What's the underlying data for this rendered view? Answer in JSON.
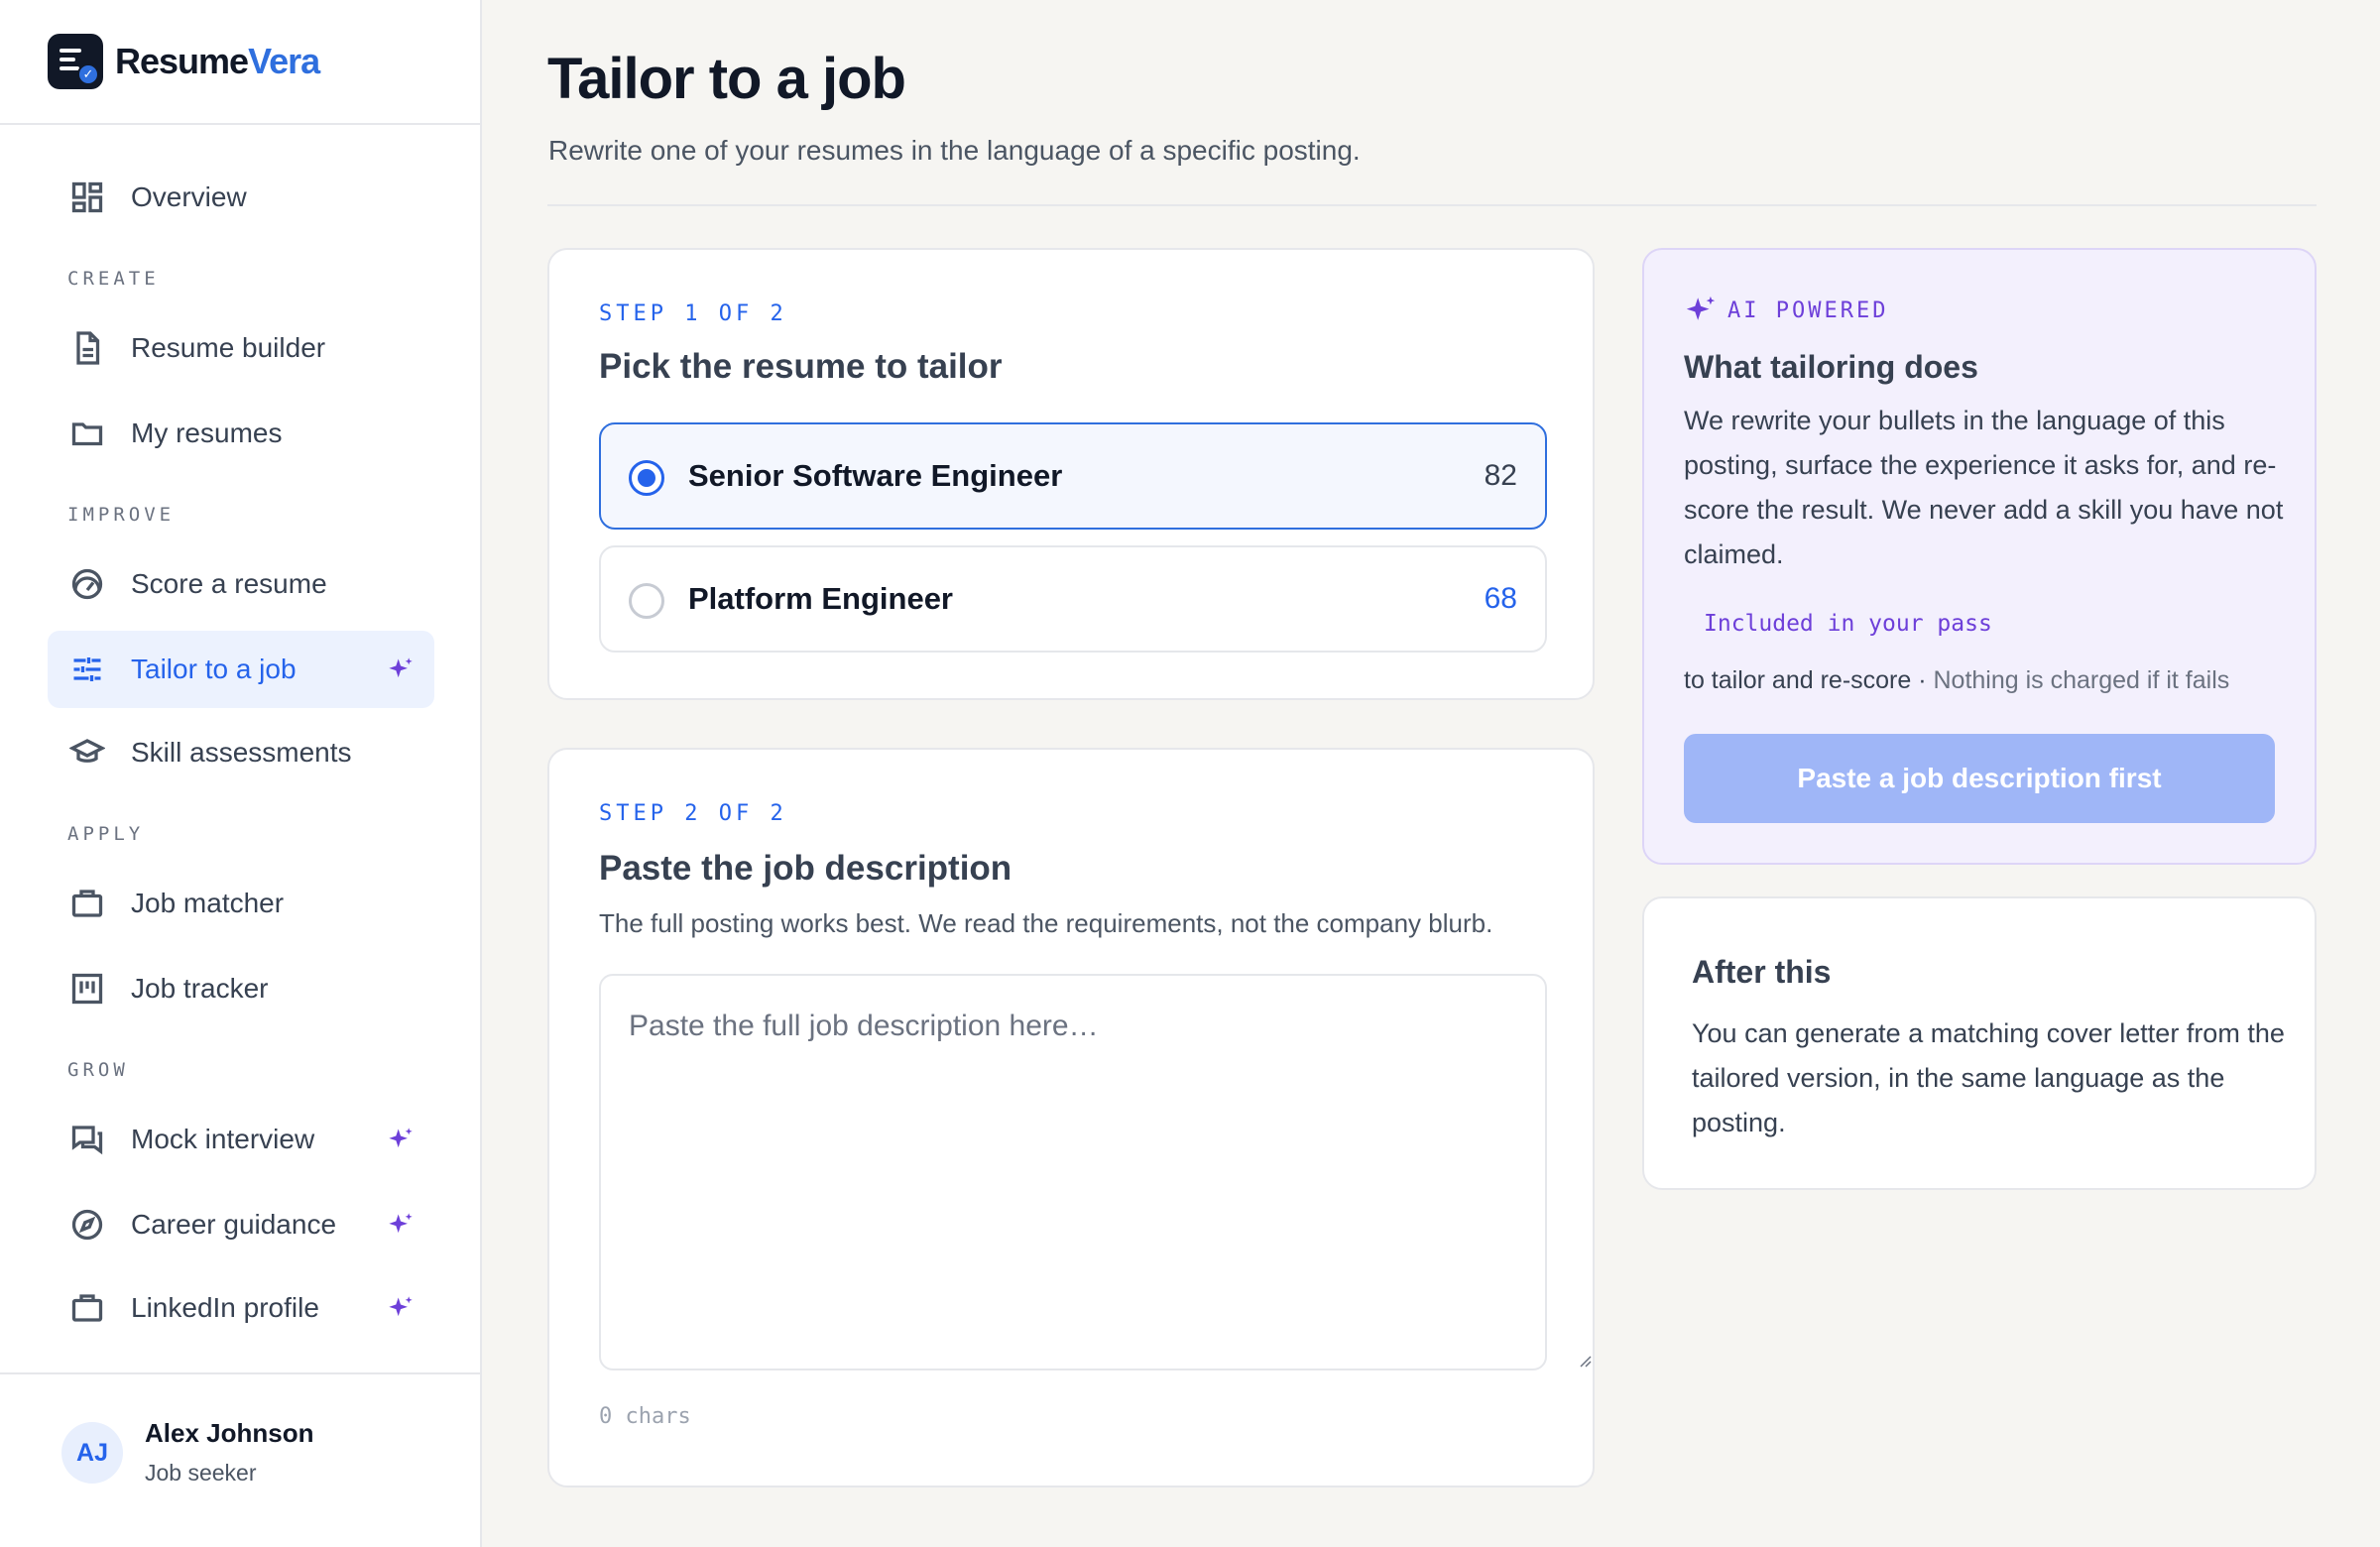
{
  "brand": {
    "name_main": "Resume",
    "name_accent": "Vera"
  },
  "sidebar": {
    "overview": "Overview",
    "sections": {
      "create": "CREATE",
      "improve": "IMPROVE",
      "apply": "APPLY",
      "grow": "GROW"
    },
    "items": {
      "resume_builder": "Resume builder",
      "my_resumes": "My resumes",
      "score_resume": "Score a resume",
      "tailor_job": "Tailor to a job",
      "skill_assessments": "Skill assessments",
      "job_matcher": "Job matcher",
      "job_tracker": "Job tracker",
      "mock_interview": "Mock interview",
      "career_guidance": "Career guidance",
      "linkedin_profile": "LinkedIn profile"
    },
    "active_item": "tailor_job"
  },
  "user": {
    "initials": "AJ",
    "name": "Alex Johnson",
    "role": "Job seeker"
  },
  "page": {
    "title": "Tailor to a job",
    "subtitle": "Rewrite one of your resumes in the language of a specific posting."
  },
  "step1": {
    "label": "STEP 1 OF 2",
    "title": "Pick the resume to tailor",
    "resumes": [
      {
        "name": "Senior Software Engineer",
        "score": "82",
        "selected": true
      },
      {
        "name": "Platform Engineer",
        "score": "68",
        "selected": false
      }
    ]
  },
  "step2": {
    "label": "STEP 2 OF 2",
    "title": "Paste the job description",
    "help": "The full posting works best. We read the requirements, not the company blurb.",
    "placeholder": "Paste the full job description here…",
    "value": "",
    "chars": "0 chars"
  },
  "ai_panel": {
    "badge": "AI POWERED",
    "title": "What tailoring does",
    "body": "We rewrite your bullets in the language of this posting, surface the experience it asks for, and re-score the result. We never add a skill you have not claimed.",
    "included": "Included in your pass",
    "note_main": "to tailor and re-score · ",
    "note_muted": "Nothing is charged if it fails",
    "button": "Paste a job description first"
  },
  "after": {
    "title": "After this",
    "body": "You can generate a matching cover letter from the tailored version, in the same language as the posting."
  },
  "colors": {
    "accent": "#2563eb",
    "ai": "#6d3fd9",
    "score_low": "#2563eb",
    "score_high": "#374151"
  },
  "icons": {
    "overview": "grid-icon",
    "resume_builder": "document-icon",
    "my_resumes": "folder-icon",
    "score_resume": "gauge-icon",
    "tailor_job": "sliders-icon",
    "skill_assessments": "graduation-cap-icon",
    "job_matcher": "briefcase-icon",
    "job_tracker": "kanban-icon",
    "mock_interview": "chat-icon",
    "career_guidance": "compass-icon",
    "linkedin_profile": "briefcase-icon",
    "ai": "sparkle-icon"
  }
}
